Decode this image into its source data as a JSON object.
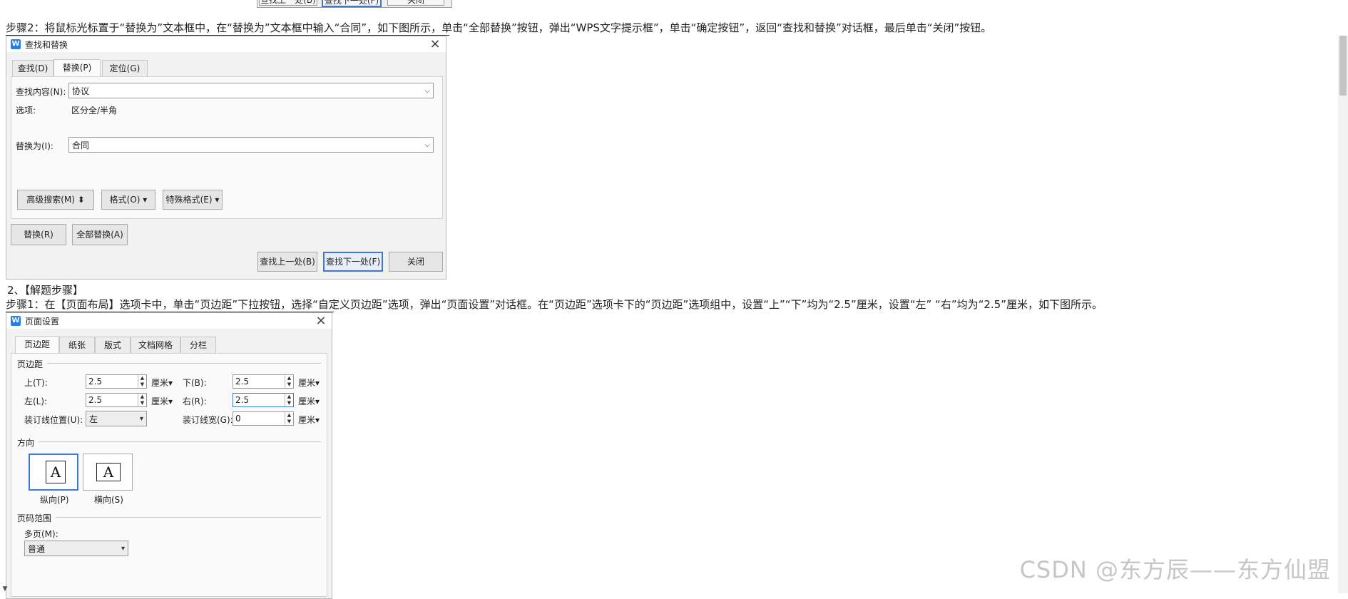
{
  "prev_dialog": {
    "btn_find_prev": "查找上一处(B)",
    "btn_find_next": "查找下一处(F)",
    "btn_close": "关闭"
  },
  "step2_text": "步骤2：将鼠标光标置于“替换为”文本框中，在“替换为”文本框中输入“合同”，如下图所示，单击“全部替换”按钮，弹出“WPS文字提示框”，单击“确定按钮”，返回“查找和替换”对话框，最后单击“关闭”按钮。",
  "find_replace": {
    "icon_letter": "W",
    "title": "查找和替换",
    "tabs": [
      "查找(D)",
      "替换(P)",
      "定位(G)"
    ],
    "find_label": "查找内容(N):",
    "find_value": "协议",
    "options_label": "选项:",
    "options_value": "区分全/半角",
    "replace_label": "替换为(I):",
    "replace_value": "合同",
    "btn_advanced": "高级搜索(M)",
    "btn_format": "格式(O)",
    "btn_special": "特殊格式(E)",
    "btn_replace": "替换(R)",
    "btn_replace_all": "全部替换(A)",
    "btn_find_prev": "查找上一处(B)",
    "btn_find_next": "查找下一处(F)",
    "btn_close": "关闭"
  },
  "section2_title": "2、【解题步骤】",
  "step1_text": "步骤1：在【页面布局】选项卡中，单击“页边距”下拉按钮，选择“自定义页边距”选项，弹出“页面设置”对话框。在“页边距”选项卡下的“页边距”选项组中，设置“上”“下”均为“2.5”厘米，设置“左” “右”均为“2.5”厘米，如下图所示。",
  "page_setup": {
    "icon_letter": "W",
    "title": "页面设置",
    "tabs": [
      "页边距",
      "纸张",
      "版式",
      "文档网格",
      "分栏"
    ],
    "margins_heading": "页边距",
    "top_label": "上(T):",
    "top_value": "2.5",
    "bottom_label": "下(B):",
    "bottom_value": "2.5",
    "left_label": "左(L):",
    "left_value": "2.5",
    "right_label": "右(R):",
    "right_value": "2.5",
    "unit": "厘米",
    "gutter_pos_label": "装订线位置(U):",
    "gutter_pos_value": "左",
    "gutter_width_label": "装订线宽(G):",
    "gutter_width_value": "0",
    "orientation_heading": "方向",
    "portrait_glyph": "A",
    "landscape_glyph": "A",
    "portrait_label": "纵向(P)",
    "landscape_label": "横向(S)",
    "page_range_heading": "页码范围",
    "multi_page_label": "多页(M):",
    "multi_page_value": "普通"
  },
  "watermark": "CSDN @东方辰——东方仙盟"
}
